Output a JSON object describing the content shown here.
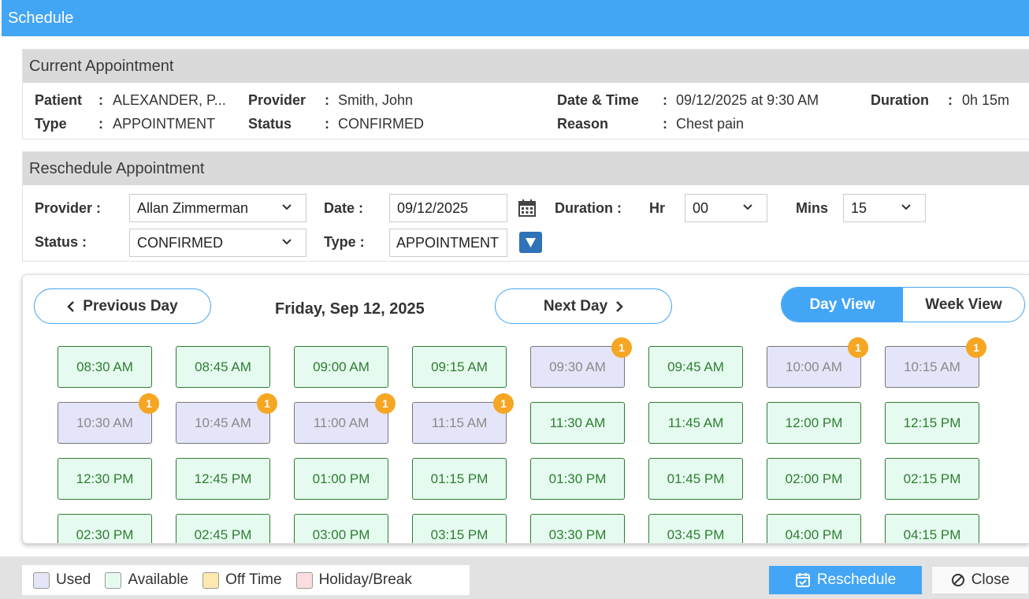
{
  "window": {
    "title": "Schedule"
  },
  "current": {
    "heading": "Current Appointment",
    "patient_label": "Patient",
    "patient": "ALEXANDER, P...",
    "provider_label": "Provider",
    "provider": "Smith, John",
    "datetime_label": "Date & Time",
    "datetime": "09/12/2025 at 9:30 AM",
    "duration_label": "Duration",
    "duration": "0h 15m",
    "type_label": "Type",
    "type": "APPOINTMENT",
    "status_label": "Status",
    "status": "CONFIRMED",
    "reason_label": "Reason",
    "reason": "Chest pain",
    "colon": ":"
  },
  "reschedule": {
    "heading": "Reschedule Appointment",
    "provider_label": "Provider :",
    "provider_value": "Allan Zimmerman",
    "date_label": "Date :",
    "date_value": "09/12/2025",
    "duration_label": "Duration :",
    "hr_label": "Hr",
    "hr_value": "00",
    "mins_label": "Mins",
    "mins_value": "15",
    "status_label": "Status :",
    "status_value": "CONFIRMED",
    "type_label": "Type :",
    "type_value": "APPOINTMENT"
  },
  "schedule": {
    "prev_label": "Previous Day",
    "next_label": "Next Day",
    "day_title": "Friday, Sep 12, 2025",
    "day_view": "Day View",
    "week_view": "Week View",
    "slots": [
      {
        "time": "08:30 AM",
        "status": "available"
      },
      {
        "time": "08:45 AM",
        "status": "available"
      },
      {
        "time": "09:00 AM",
        "status": "available"
      },
      {
        "time": "09:15 AM",
        "status": "available"
      },
      {
        "time": "09:30 AM",
        "status": "used",
        "count": "1"
      },
      {
        "time": "09:45 AM",
        "status": "available"
      },
      {
        "time": "10:00 AM",
        "status": "used",
        "count": "1"
      },
      {
        "time": "10:15 AM",
        "status": "used",
        "count": "1"
      },
      {
        "time": "10:30 AM",
        "status": "used",
        "count": "1"
      },
      {
        "time": "10:45 AM",
        "status": "used",
        "count": "1"
      },
      {
        "time": "11:00 AM",
        "status": "used",
        "count": "1"
      },
      {
        "time": "11:15 AM",
        "status": "used",
        "count": "1"
      },
      {
        "time": "11:30 AM",
        "status": "available"
      },
      {
        "time": "11:45 AM",
        "status": "available"
      },
      {
        "time": "12:00 PM",
        "status": "available"
      },
      {
        "time": "12:15 PM",
        "status": "available"
      },
      {
        "time": "12:30 PM",
        "status": "available"
      },
      {
        "time": "12:45 PM",
        "status": "available"
      },
      {
        "time": "01:00 PM",
        "status": "available"
      },
      {
        "time": "01:15 PM",
        "status": "available"
      },
      {
        "time": "01:30 PM",
        "status": "available"
      },
      {
        "time": "01:45 PM",
        "status": "available"
      },
      {
        "time": "02:00 PM",
        "status": "available"
      },
      {
        "time": "02:15 PM",
        "status": "available"
      },
      {
        "time": "02:30 PM",
        "status": "available"
      },
      {
        "time": "02:45 PM",
        "status": "available"
      },
      {
        "time": "03:00 PM",
        "status": "available"
      },
      {
        "time": "03:15 PM",
        "status": "available"
      },
      {
        "time": "03:30 PM",
        "status": "available"
      },
      {
        "time": "03:45 PM",
        "status": "available"
      },
      {
        "time": "04:00 PM",
        "status": "available"
      },
      {
        "time": "04:15 PM",
        "status": "available"
      }
    ]
  },
  "legend": {
    "used": "Used",
    "available": "Available",
    "off_time": "Off Time",
    "holiday": "Holiday/Break",
    "colors": {
      "used": "#e4e5f8",
      "available": "#e6fbf0",
      "off_time": "#fde9b0",
      "holiday": "#fbdde0"
    }
  },
  "footer": {
    "reschedule_label": "Reschedule",
    "close_label": "Close"
  },
  "colors": {
    "accent": "#42a5f5",
    "available_text": "#2e7d32",
    "badge": "#f5a623"
  }
}
